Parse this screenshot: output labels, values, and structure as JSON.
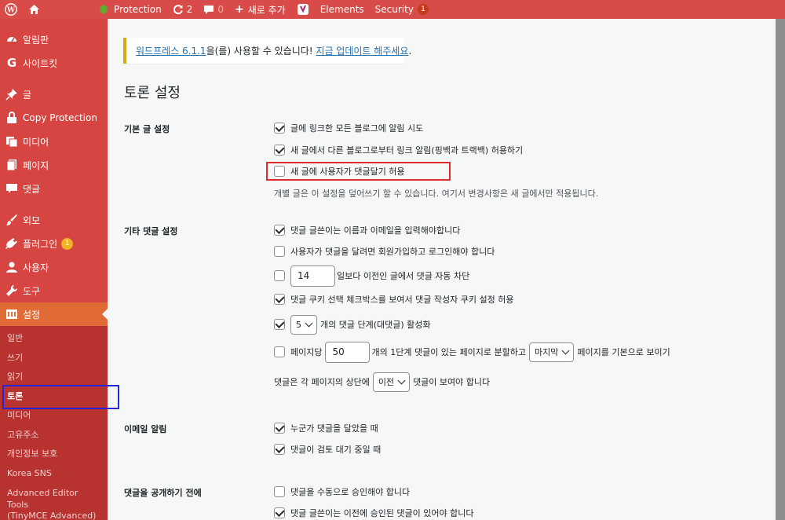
{
  "adminbar": {
    "protection_label": "Protection",
    "updates_count": "2",
    "comments_count": "0",
    "new_label": "새로 추가",
    "elements_label": "Elements",
    "security_label": "Security",
    "security_badge": "1"
  },
  "sidebar": {
    "items": [
      {
        "label": "알림판",
        "icon": "dashboard-icon"
      },
      {
        "label": "사이트킷",
        "icon": "google-icon"
      },
      {
        "label": "글",
        "icon": "pin-icon"
      },
      {
        "label": "Copy Protection",
        "icon": "lock-icon"
      },
      {
        "label": "미디어",
        "icon": "media-icon"
      },
      {
        "label": "페이지",
        "icon": "page-icon"
      },
      {
        "label": "댓글",
        "icon": "comment-icon"
      },
      {
        "label": "외모",
        "icon": "brush-icon"
      },
      {
        "label": "플러그인",
        "icon": "plugin-icon",
        "badge": "1"
      },
      {
        "label": "사용자",
        "icon": "user-icon"
      },
      {
        "label": "도구",
        "icon": "wrench-icon"
      },
      {
        "label": "설정",
        "icon": "settings-icon"
      }
    ],
    "submenu": [
      "일반",
      "쓰기",
      "읽기",
      "토론",
      "미디어",
      "고유주소",
      "개인정보 보호",
      "Korea SNS",
      "Advanced Editor Tools",
      "(TinyMCE Advanced)"
    ]
  },
  "notice": {
    "link1": "워드프레스 6.1.1",
    "text": "을(를) 사용할 수 있습니다! ",
    "link2": "지금 업데이트 해주세요",
    "end": "."
  },
  "page": {
    "title": "토론 설정",
    "sections": {
      "default": "기본 글 설정",
      "other": "기타 댓글 설정",
      "email": "이메일 알림",
      "before": "댓글을 공개하기 전에"
    },
    "rows": {
      "pingback": "글에 링크한 모든 블로그에 알림 시도",
      "ping_allow": "새 글에서 다른 블로그로부터 링크 알림(핑백과 트랙백) 허용하기",
      "allow_comments": "새 글에 사용자가 댓글달기 허용",
      "default_desc": "개별 글은 이 설정을 덮어쓰기 할 수 있습니다. 여기서 변경사항은 새 글에서만 적용됩니다.",
      "require_name": "댓글 글쓴이는 이름과 이메일을 입력해야합니다",
      "registration": "사용자가 댓글을 달려면 회원가입하고 로그인해야 합니다",
      "close_days_value": "14",
      "close_days_text": "일보다 이전인 글에서 댓글 자동 차단",
      "cookies": "댓글 쿠키 선택 체크박스를 보여서 댓글 작성자 쿠키 설정 허용",
      "thread_depth_value": "5",
      "thread_text": "개의 댓글 단계(대댓글) 활성화",
      "page_prefix": "페이지당",
      "per_page_value": "50",
      "page_mid": "개의 1단계 댓글이 있는 페이지로 분할하고",
      "page_select": "마지막",
      "page_end": "페이지를 기본으로 보이기",
      "order_prefix": "댓글은 각 페이지의 상단에",
      "order_select": "이전",
      "order_end": "댓글이 보여야 합니다",
      "notify_comment": "누군가 댓글을 달았을 때",
      "notify_moderation": "댓글이 검토 대기 중일 때",
      "manual_approve": "댓글을 수동으로 승인해야 합니다",
      "prev_approved": "댓글 글쓴이는 이전에 승인된 댓글이 있어야 합니다"
    }
  },
  "colors": {
    "adminbar": "#d94b48",
    "sidebar": "#d64541",
    "active": "#e06b37",
    "submenu": "#b8322f",
    "highlight_red": "#e02b2b",
    "highlight_blue": "#2727d9"
  }
}
